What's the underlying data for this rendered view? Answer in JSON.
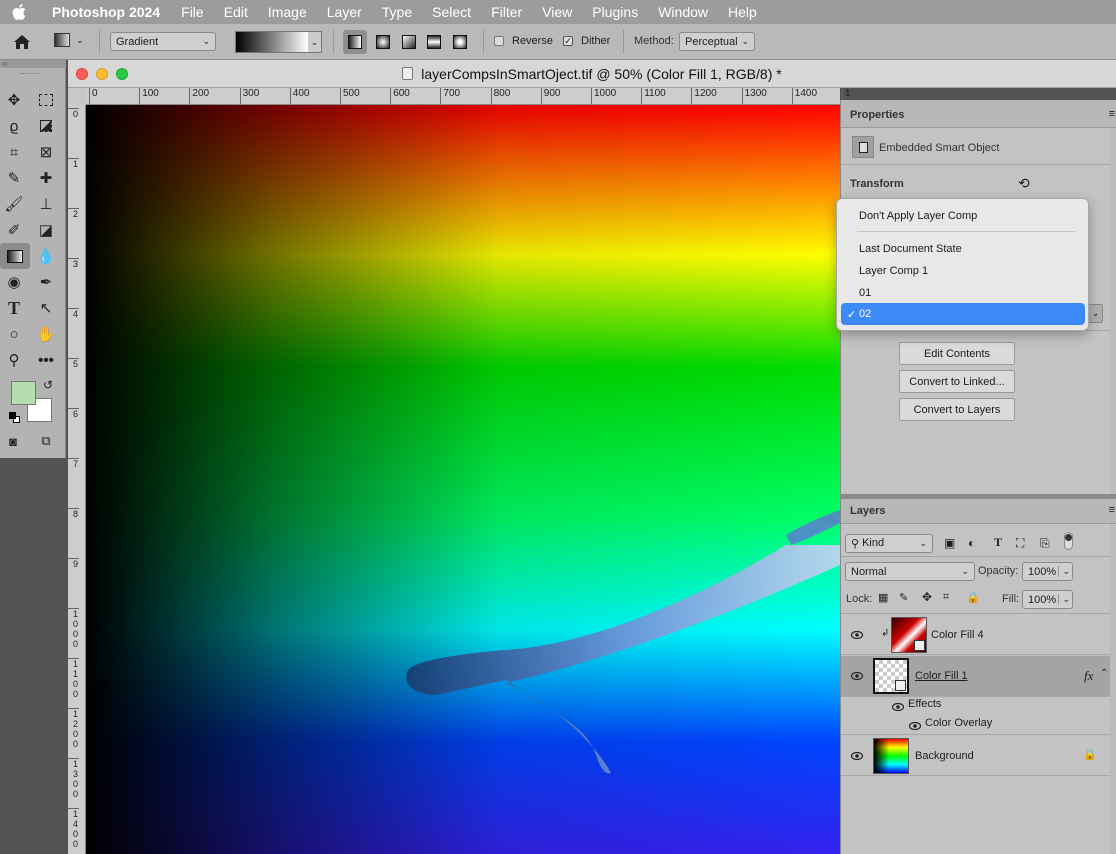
{
  "menubar": {
    "app": "Photoshop 2024",
    "items": [
      "File",
      "Edit",
      "Image",
      "Layer",
      "Type",
      "Select",
      "Filter",
      "View",
      "Plugins",
      "Window",
      "Help"
    ]
  },
  "options": {
    "preset": "Gradient",
    "reverse": "Reverse",
    "dither": "Dither",
    "method_label": "Method:",
    "method_value": "Perceptual"
  },
  "document": {
    "title": "layerCompsInSmartOject.tif @ 50% (Color Fill 1, RGB/8) *",
    "ruler_h": [
      "0",
      "100",
      "200",
      "300",
      "400",
      "500",
      "600",
      "700",
      "800",
      "900",
      "1000",
      "1100",
      "1200",
      "1300",
      "1400",
      "1"
    ],
    "ruler_v": [
      "0",
      "1",
      "2",
      "3",
      "4",
      "5",
      "6",
      "7",
      "8",
      "9",
      "1 0 0 0",
      "1 1 0 0",
      "1 2 0 0",
      "1 3 0 0",
      "1 4 0 0"
    ]
  },
  "properties": {
    "tab": "Properties",
    "type": "Embedded Smart Object",
    "transform": "Transform",
    "buttons": [
      "Edit Contents",
      "Convert to Linked...",
      "Convert to Layers"
    ]
  },
  "dropdown": {
    "items": [
      "Don't Apply Layer Comp",
      "Last Document State",
      "Layer Comp 1",
      "01",
      "02"
    ],
    "selected": "02",
    "check": "✓"
  },
  "layers": {
    "tab": "Layers",
    "filter": "Kind",
    "blend": "Normal",
    "opacity_label": "Opacity:",
    "opacity": "100%",
    "lock_label": "Lock:",
    "fill_label": "Fill:",
    "fill": "100%",
    "rows": [
      {
        "name": "Color Fill 4"
      },
      {
        "name": "Color Fill 1"
      },
      {
        "name": "Background"
      }
    ],
    "effects": "Effects",
    "color_overlay": "Color Overlay",
    "fx": "fx"
  },
  "colors": {
    "foreground": "#b6ddb0",
    "background": "#ffffff",
    "selection": "#3b8af7"
  }
}
